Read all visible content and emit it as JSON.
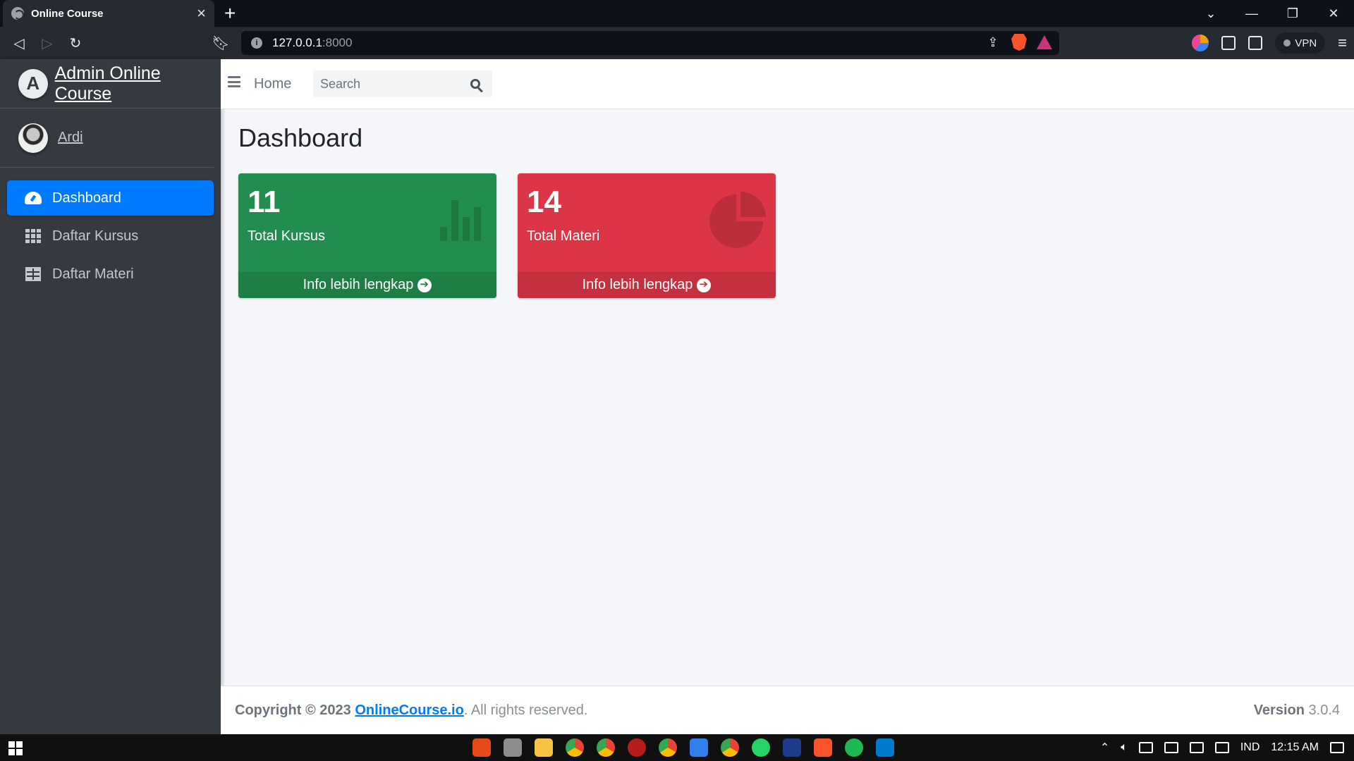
{
  "browser": {
    "tab_title": "Online Course",
    "tab_close": "×",
    "new_tab": "+",
    "url_host": "127.0.0.1",
    "url_port": ":8000",
    "vpn_label": "VPN",
    "window_controls": [
      "⌄",
      "—",
      "❐",
      "✕"
    ]
  },
  "sidebar": {
    "brand_text": "Admin Online Course",
    "brand_logo": "A",
    "user_name": "Ardi",
    "items": [
      {
        "label": "Dashboard",
        "icon": "gauge-icon",
        "active": true
      },
      {
        "label": "Daftar Kursus",
        "icon": "grid-icon",
        "active": false
      },
      {
        "label": "Daftar Materi",
        "icon": "table-icon",
        "active": false
      }
    ]
  },
  "topbar": {
    "home_label": "Home",
    "search_placeholder": "Search"
  },
  "main": {
    "page_title": "Dashboard",
    "cards": [
      {
        "count": "11",
        "label": "Total Kursus",
        "footer": "Info lebih lengkap",
        "color": "#218d4f",
        "icon": "chart-bar-icon"
      },
      {
        "count": "14",
        "label": "Total Materi",
        "footer": "Info lebih lengkap",
        "color": "#dc3545",
        "icon": "chart-pie-icon"
      }
    ]
  },
  "footer": {
    "copyright": "Copyright © 2023",
    "link": "OnlineCourse.io",
    "rights": ". All rights reserved.",
    "version_label": "Version",
    "version_value": "3.0.4"
  },
  "taskbar": {
    "language": "IND",
    "time": "12:15 AM"
  },
  "colors": {
    "accent": "#007bff",
    "sidebar_bg": "#343a40",
    "success": "#218d4f",
    "danger": "#dc3545"
  }
}
